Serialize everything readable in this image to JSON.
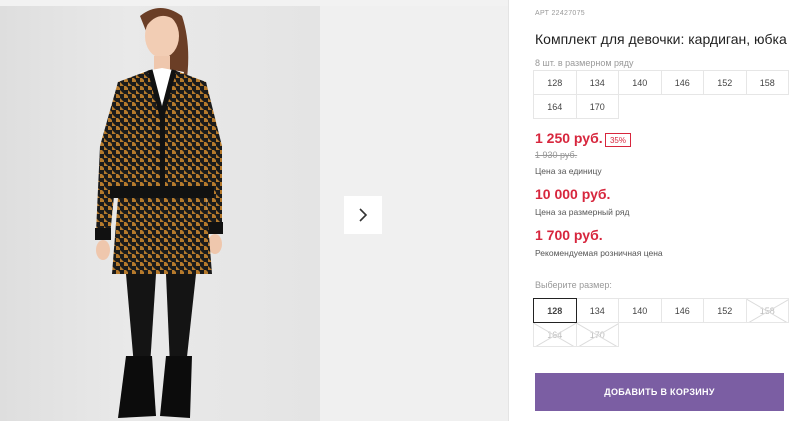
{
  "product": {
    "article": "АРТ 22427075",
    "title": "Комплект для девочки: кардиган, юбка",
    "pack_note": "8 шт. в размерном ряду",
    "pack_sizes": [
      "128",
      "134",
      "140",
      "146",
      "152",
      "158",
      "164",
      "170"
    ]
  },
  "pricing": {
    "unit_price": "1 250 руб.",
    "discount": "35%",
    "old_price": "1 930 руб.",
    "unit_label": "Цена за единицу",
    "row_price": "10 000 руб.",
    "row_label": "Цена за размерный ряд",
    "retail_price": "1 700 руб.",
    "retail_label": "Рекомендуемая розничная цена"
  },
  "size_picker": {
    "label": "Выберите размер:",
    "options": [
      "128",
      "134",
      "140",
      "146",
      "152",
      "158",
      "164",
      "170"
    ],
    "selected": "128",
    "unavailable": [
      "158",
      "164",
      "170"
    ]
  },
  "gallery": {
    "next_icon": "chevron-right-icon"
  },
  "actions": {
    "add_to_cart": "ДОБАВИТЬ В КОРЗИНУ"
  },
  "colors": {
    "price_red": "#d7263d",
    "button_purple": "#7b5ea3"
  }
}
